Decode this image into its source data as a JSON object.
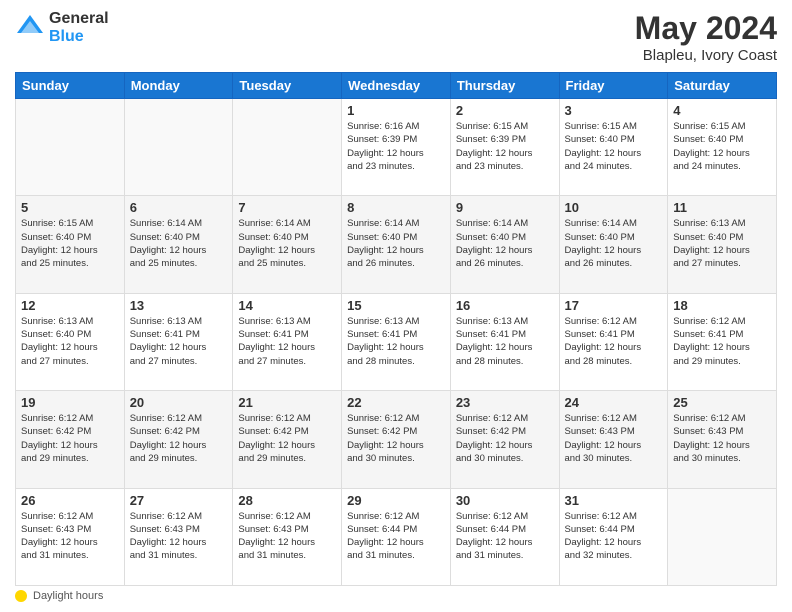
{
  "header": {
    "logo_general": "General",
    "logo_blue": "Blue",
    "title": "May 2024",
    "location": "Blapleu, Ivory Coast"
  },
  "weekdays": [
    "Sunday",
    "Monday",
    "Tuesday",
    "Wednesday",
    "Thursday",
    "Friday",
    "Saturday"
  ],
  "footer": {
    "label": "Daylight hours"
  },
  "weeks": [
    {
      "days": [
        {
          "num": "",
          "detail": ""
        },
        {
          "num": "",
          "detail": ""
        },
        {
          "num": "",
          "detail": ""
        },
        {
          "num": "1",
          "detail": "Sunrise: 6:16 AM\nSunset: 6:39 PM\nDaylight: 12 hours\nand 23 minutes."
        },
        {
          "num": "2",
          "detail": "Sunrise: 6:15 AM\nSunset: 6:39 PM\nDaylight: 12 hours\nand 23 minutes."
        },
        {
          "num": "3",
          "detail": "Sunrise: 6:15 AM\nSunset: 6:40 PM\nDaylight: 12 hours\nand 24 minutes."
        },
        {
          "num": "4",
          "detail": "Sunrise: 6:15 AM\nSunset: 6:40 PM\nDaylight: 12 hours\nand 24 minutes."
        }
      ]
    },
    {
      "days": [
        {
          "num": "5",
          "detail": "Sunrise: 6:15 AM\nSunset: 6:40 PM\nDaylight: 12 hours\nand 25 minutes."
        },
        {
          "num": "6",
          "detail": "Sunrise: 6:14 AM\nSunset: 6:40 PM\nDaylight: 12 hours\nand 25 minutes."
        },
        {
          "num": "7",
          "detail": "Sunrise: 6:14 AM\nSunset: 6:40 PM\nDaylight: 12 hours\nand 25 minutes."
        },
        {
          "num": "8",
          "detail": "Sunrise: 6:14 AM\nSunset: 6:40 PM\nDaylight: 12 hours\nand 26 minutes."
        },
        {
          "num": "9",
          "detail": "Sunrise: 6:14 AM\nSunset: 6:40 PM\nDaylight: 12 hours\nand 26 minutes."
        },
        {
          "num": "10",
          "detail": "Sunrise: 6:14 AM\nSunset: 6:40 PM\nDaylight: 12 hours\nand 26 minutes."
        },
        {
          "num": "11",
          "detail": "Sunrise: 6:13 AM\nSunset: 6:40 PM\nDaylight: 12 hours\nand 27 minutes."
        }
      ]
    },
    {
      "days": [
        {
          "num": "12",
          "detail": "Sunrise: 6:13 AM\nSunset: 6:40 PM\nDaylight: 12 hours\nand 27 minutes."
        },
        {
          "num": "13",
          "detail": "Sunrise: 6:13 AM\nSunset: 6:41 PM\nDaylight: 12 hours\nand 27 minutes."
        },
        {
          "num": "14",
          "detail": "Sunrise: 6:13 AM\nSunset: 6:41 PM\nDaylight: 12 hours\nand 27 minutes."
        },
        {
          "num": "15",
          "detail": "Sunrise: 6:13 AM\nSunset: 6:41 PM\nDaylight: 12 hours\nand 28 minutes."
        },
        {
          "num": "16",
          "detail": "Sunrise: 6:13 AM\nSunset: 6:41 PM\nDaylight: 12 hours\nand 28 minutes."
        },
        {
          "num": "17",
          "detail": "Sunrise: 6:12 AM\nSunset: 6:41 PM\nDaylight: 12 hours\nand 28 minutes."
        },
        {
          "num": "18",
          "detail": "Sunrise: 6:12 AM\nSunset: 6:41 PM\nDaylight: 12 hours\nand 29 minutes."
        }
      ]
    },
    {
      "days": [
        {
          "num": "19",
          "detail": "Sunrise: 6:12 AM\nSunset: 6:42 PM\nDaylight: 12 hours\nand 29 minutes."
        },
        {
          "num": "20",
          "detail": "Sunrise: 6:12 AM\nSunset: 6:42 PM\nDaylight: 12 hours\nand 29 minutes."
        },
        {
          "num": "21",
          "detail": "Sunrise: 6:12 AM\nSunset: 6:42 PM\nDaylight: 12 hours\nand 29 minutes."
        },
        {
          "num": "22",
          "detail": "Sunrise: 6:12 AM\nSunset: 6:42 PM\nDaylight: 12 hours\nand 30 minutes."
        },
        {
          "num": "23",
          "detail": "Sunrise: 6:12 AM\nSunset: 6:42 PM\nDaylight: 12 hours\nand 30 minutes."
        },
        {
          "num": "24",
          "detail": "Sunrise: 6:12 AM\nSunset: 6:43 PM\nDaylight: 12 hours\nand 30 minutes."
        },
        {
          "num": "25",
          "detail": "Sunrise: 6:12 AM\nSunset: 6:43 PM\nDaylight: 12 hours\nand 30 minutes."
        }
      ]
    },
    {
      "days": [
        {
          "num": "26",
          "detail": "Sunrise: 6:12 AM\nSunset: 6:43 PM\nDaylight: 12 hours\nand 31 minutes."
        },
        {
          "num": "27",
          "detail": "Sunrise: 6:12 AM\nSunset: 6:43 PM\nDaylight: 12 hours\nand 31 minutes."
        },
        {
          "num": "28",
          "detail": "Sunrise: 6:12 AM\nSunset: 6:43 PM\nDaylight: 12 hours\nand 31 minutes."
        },
        {
          "num": "29",
          "detail": "Sunrise: 6:12 AM\nSunset: 6:44 PM\nDaylight: 12 hours\nand 31 minutes."
        },
        {
          "num": "30",
          "detail": "Sunrise: 6:12 AM\nSunset: 6:44 PM\nDaylight: 12 hours\nand 31 minutes."
        },
        {
          "num": "31",
          "detail": "Sunrise: 6:12 AM\nSunset: 6:44 PM\nDaylight: 12 hours\nand 32 minutes."
        },
        {
          "num": "",
          "detail": ""
        }
      ]
    }
  ]
}
